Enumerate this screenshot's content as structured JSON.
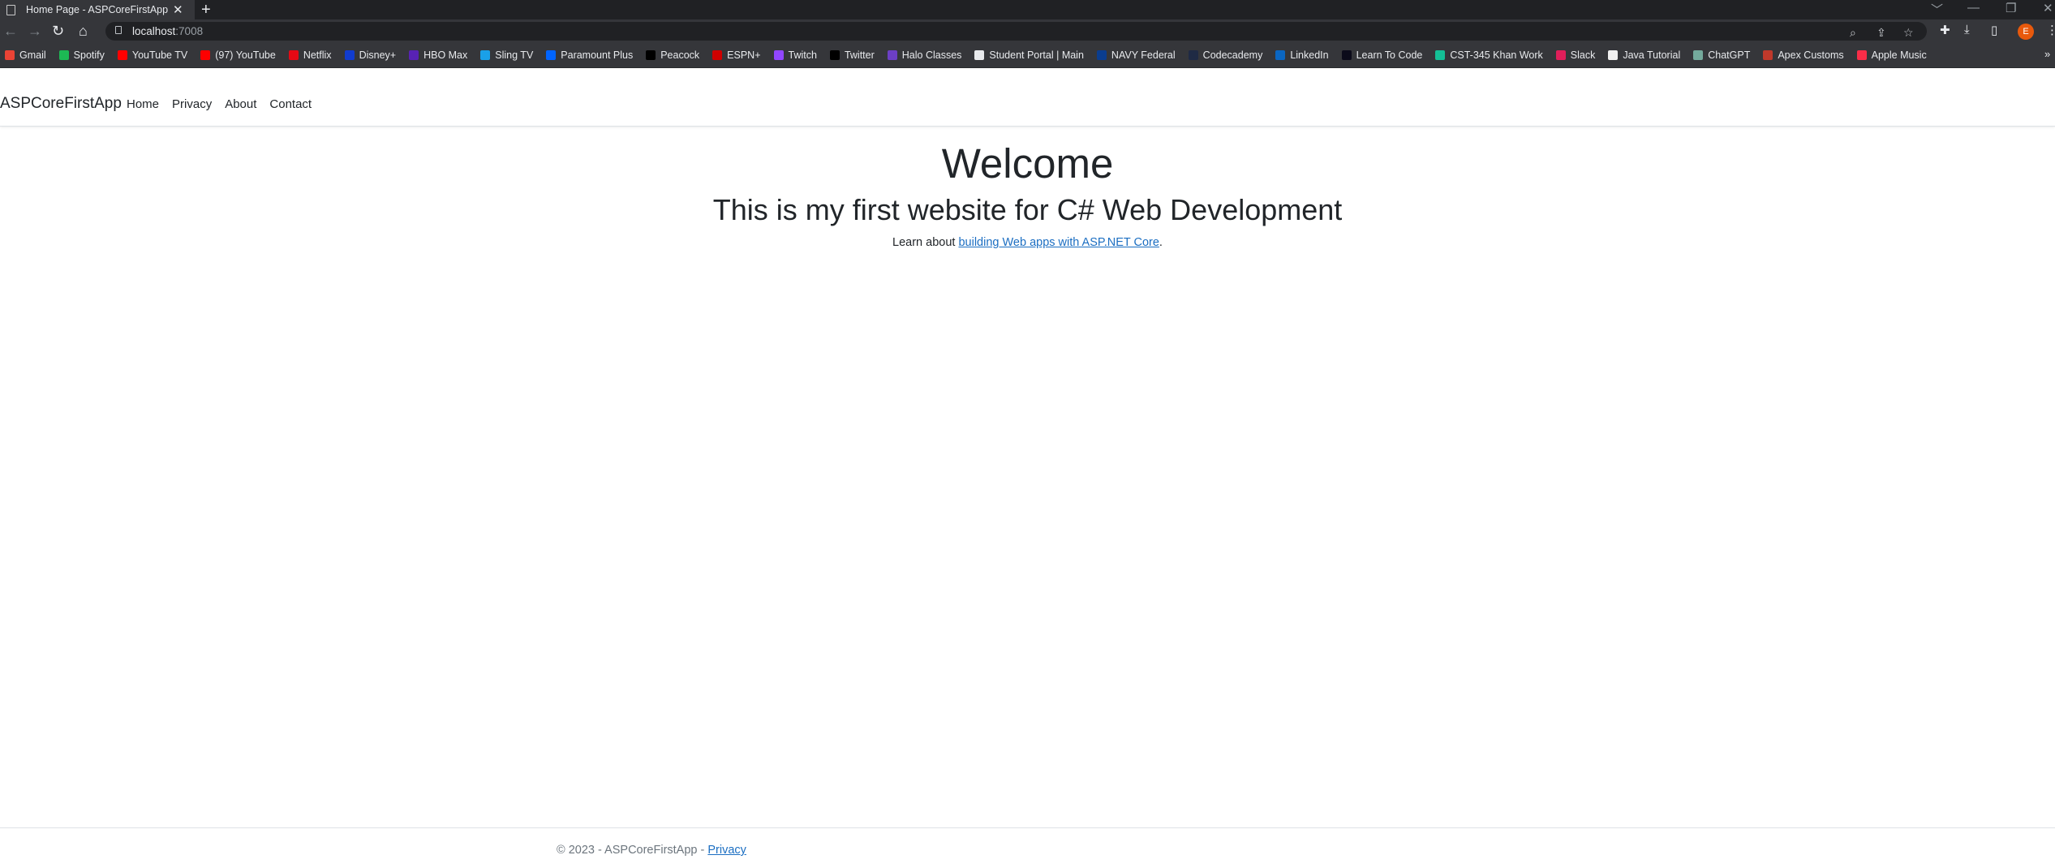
{
  "browser": {
    "tab_title": "Home Page - ASPCoreFirstApp",
    "tab_close": "✕",
    "new_tab": "+",
    "url_host": "localhost",
    "url_port": ":7008",
    "profile_initial": "E",
    "window_controls": [
      "﹀",
      "—",
      "❐",
      "✕"
    ],
    "bookmarks": [
      {
        "label": "Gmail",
        "color": "#ea4335"
      },
      {
        "label": "Spotify",
        "color": "#1db954"
      },
      {
        "label": "YouTube TV",
        "color": "#ff0000"
      },
      {
        "label": "(97) YouTube",
        "color": "#ff0000"
      },
      {
        "label": "Netflix",
        "color": "#e50914"
      },
      {
        "label": "Disney+",
        "color": "#113ccf"
      },
      {
        "label": "HBO Max",
        "color": "#5822b4"
      },
      {
        "label": "Sling TV",
        "color": "#1aa0e8"
      },
      {
        "label": "Paramount Plus",
        "color": "#0064ff"
      },
      {
        "label": "Peacock",
        "color": "#000000"
      },
      {
        "label": "ESPN+",
        "color": "#d00000"
      },
      {
        "label": "Twitch",
        "color": "#9146ff"
      },
      {
        "label": "Twitter",
        "color": "#000000"
      },
      {
        "label": "Halo Classes",
        "color": "#6c3fc5"
      },
      {
        "label": "Student Portal | Main",
        "color": "#e8eaed"
      },
      {
        "label": "NAVY Federal",
        "color": "#0a3d8f"
      },
      {
        "label": "Codecademy",
        "color": "#1f2a44"
      },
      {
        "label": "LinkedIn",
        "color": "#0a66c2"
      },
      {
        "label": "Learn To Code",
        "color": "#0b0b1a"
      },
      {
        "label": "CST-345 Khan Work",
        "color": "#14bf96"
      },
      {
        "label": "Slack",
        "color": "#e01e5a"
      },
      {
        "label": "Java Tutorial",
        "color": "#f0f0f0"
      },
      {
        "label": "ChatGPT",
        "color": "#74aa9c"
      },
      {
        "label": "Apex Customs",
        "color": "#c0392b"
      },
      {
        "label": "Apple Music",
        "color": "#fa2d48"
      }
    ],
    "bookmarks_more": "»"
  },
  "site": {
    "brand": "ASPCoreFirstApp",
    "nav": [
      "Home",
      "Privacy",
      "About",
      "Contact"
    ],
    "heading": "Welcome",
    "subheading": "This is my first website for C# Web Development",
    "learn_prefix": "Learn about ",
    "learn_link": "building Web apps with ASP.NET Core",
    "learn_suffix": ".",
    "footer_text": "© 2023 - ASPCoreFirstApp - ",
    "footer_link": "Privacy"
  }
}
